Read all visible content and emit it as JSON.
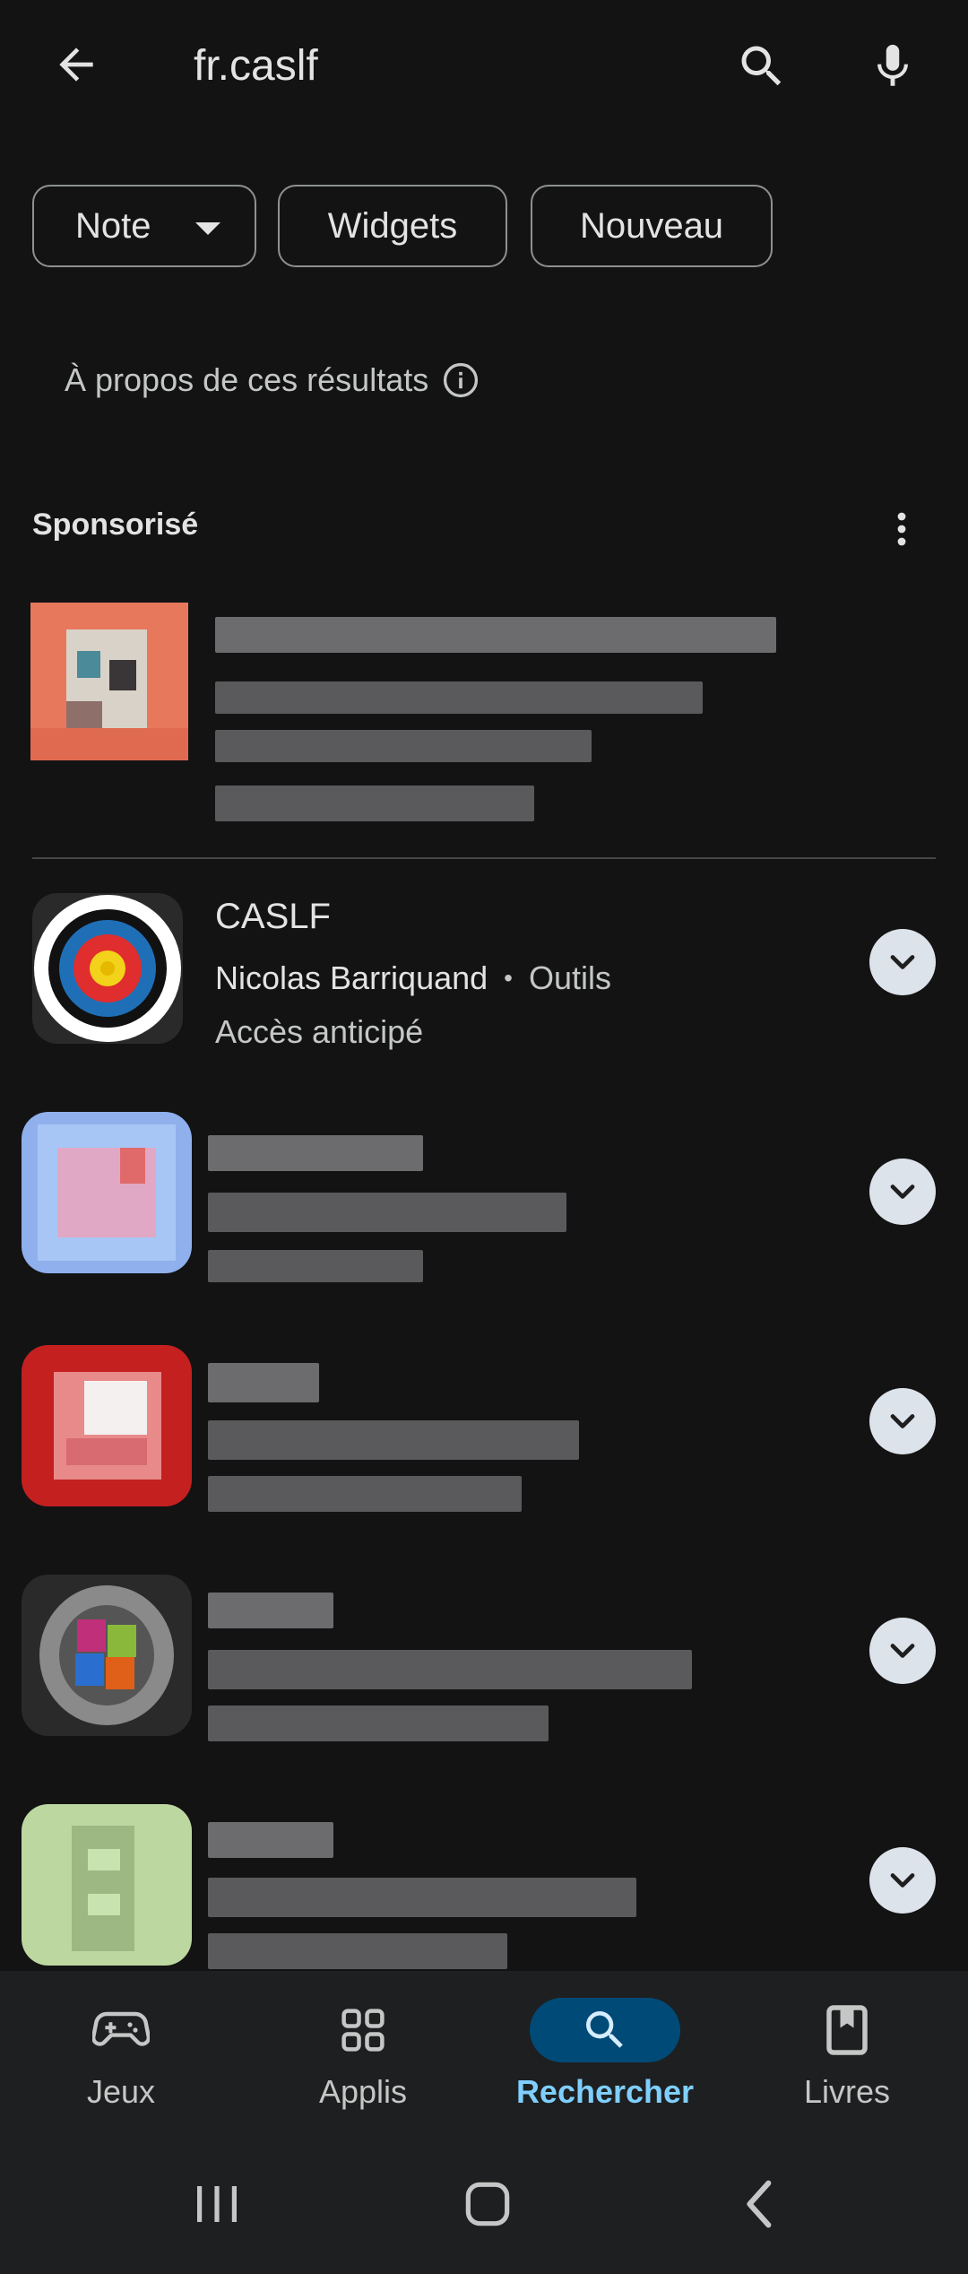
{
  "search": {
    "query": "fr.caslf"
  },
  "filters": [
    {
      "label": "Note"
    },
    {
      "label": "Widgets"
    },
    {
      "label": "Nouveau"
    }
  ],
  "about_results": "À propos de ces résultats",
  "sponsored_label": "Sponsorisé",
  "results": [
    {
      "title": "CASLF",
      "developer": "Nicolas Barriquand",
      "separator": "•",
      "category": "Outils",
      "status": "Accès anticipé"
    }
  ],
  "bottom_nav": [
    {
      "label": "Jeux",
      "icon": "gamepad-icon"
    },
    {
      "label": "Applis",
      "icon": "apps-grid-icon"
    },
    {
      "label": "Rechercher",
      "icon": "search-icon",
      "active": true
    },
    {
      "label": "Livres",
      "icon": "bookmark-book-icon"
    }
  ],
  "colors": {
    "background": "#131314",
    "chip_border": "#8e918f",
    "active_nav_pill": "#004a77",
    "active_nav_text": "#7fcfff",
    "expand_button": "#dde3ea"
  }
}
